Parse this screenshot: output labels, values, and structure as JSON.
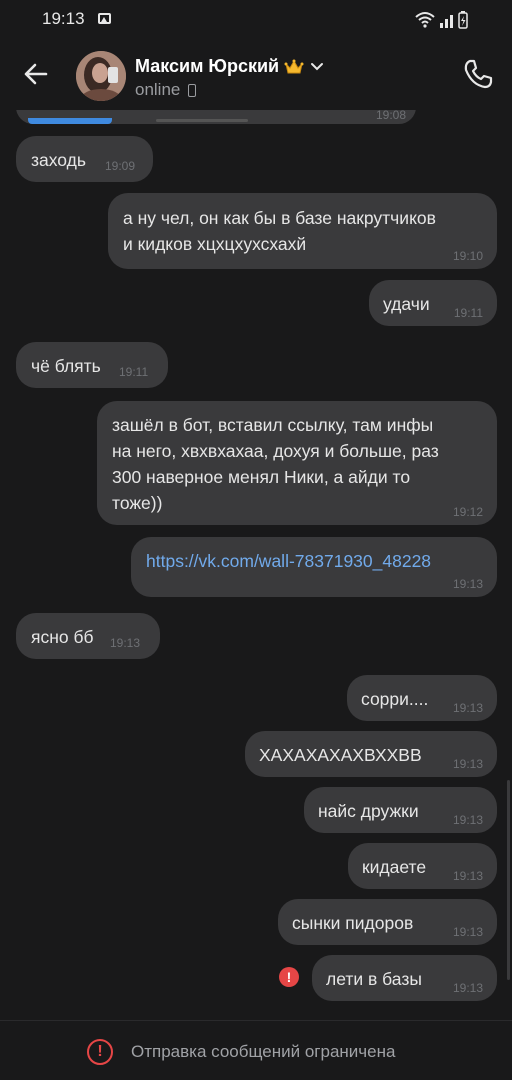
{
  "status_bar": {
    "time": "19:13"
  },
  "header": {
    "contact_name": "Максим Юрский",
    "status": "online"
  },
  "partial_message_time": "19:08",
  "messages": [
    {
      "text": "заходь",
      "time": "19:09",
      "side": "in"
    },
    {
      "text_lines": [
        "а ну чел, он как бы в базе накрутчиков",
        "и кидков хцхцхухсхахй"
      ],
      "time": "19:10",
      "side": "out"
    },
    {
      "text": "удачи",
      "time": "19:11",
      "side": "out"
    },
    {
      "text": "чё блять",
      "time": "19:11",
      "side": "in"
    },
    {
      "text_lines": [
        "зашёл в бот, вставил ссылку, там инфы",
        "на него, хвхвхахаа, дохуя и больше, раз",
        "300 наверное менял Ники, а айди то",
        "тоже))"
      ],
      "time": "19:12",
      "side": "out"
    },
    {
      "text": "https://vk.com/wall-78371930_48228",
      "time": "19:13",
      "side": "out",
      "is_link": true
    },
    {
      "text": "ясно бб",
      "time": "19:13",
      "side": "in"
    },
    {
      "text": "сорри....",
      "time": "19:13",
      "side": "out"
    },
    {
      "text": "ХАХАХАХАХВХХВВ",
      "time": "19:13",
      "side": "out"
    },
    {
      "text": "найс дружки",
      "time": "19:13",
      "side": "out"
    },
    {
      "text": "кидаете",
      "time": "19:13",
      "side": "out"
    },
    {
      "text": "сынки пидоров",
      "time": "19:13",
      "side": "out"
    },
    {
      "text": "лети в базы",
      "time": "19:13",
      "side": "out",
      "failed": true
    }
  ],
  "footer": {
    "text": "Отправка сообщений ограничена"
  },
  "colors": {
    "background": "#19191a",
    "bubble": "#3a3a3c",
    "link": "#71aaeb",
    "error": "#e64646",
    "accent": "#3f8ae0"
  },
  "icons": [
    "back-arrow-icon",
    "crown-icon",
    "chevron-down-icon",
    "phone-icon",
    "error-icon",
    "wifi-icon",
    "signal-icon",
    "battery-icon",
    "image-icon"
  ]
}
